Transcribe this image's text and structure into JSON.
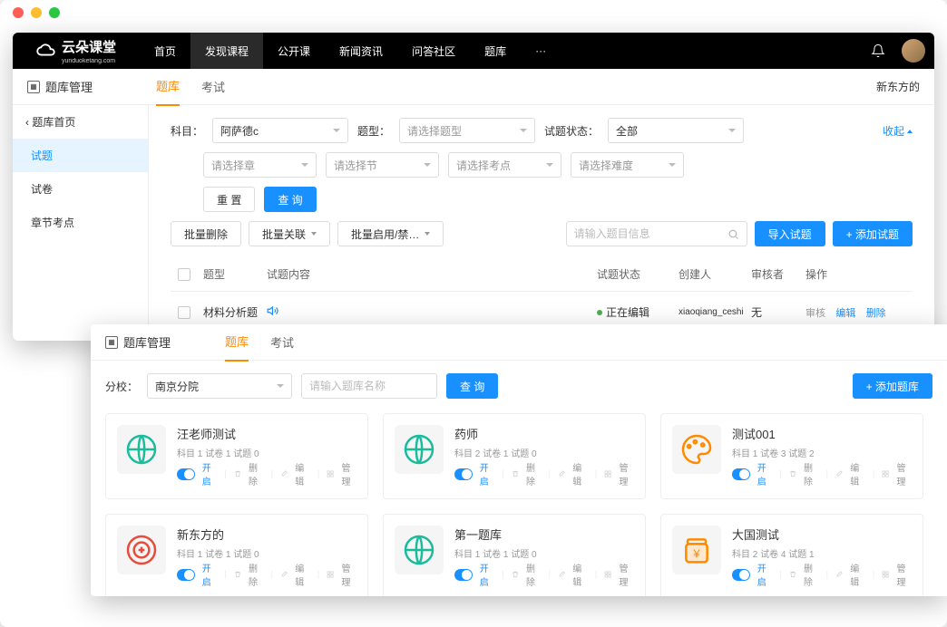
{
  "logo": {
    "main": "云朵课堂",
    "sub": "yunduoketang.com"
  },
  "topnav": [
    "首页",
    "发现课程",
    "公开课",
    "新闻资讯",
    "问答社区",
    "题库",
    "···"
  ],
  "topnav_active": 1,
  "w1": {
    "title": "题库管理",
    "tabs": [
      "题库",
      "考试"
    ],
    "tab_active": 0,
    "account": "新东方的",
    "breadcrumb": "‹ 题库首页",
    "side": [
      "试题",
      "试卷",
      "章节考点"
    ],
    "side_active": 0,
    "filters": {
      "subject_label": "科目：",
      "subject_val": "阿萨德c",
      "type_label": "题型：",
      "type_ph": "请选择题型",
      "status_label": "试题状态：",
      "status_val": "全部",
      "chapter_ph": "请选择章",
      "section_ph": "请选择节",
      "point_ph": "请选择考点",
      "difficulty_ph": "请选择难度",
      "collapse": "收起"
    },
    "buttons": {
      "reset": "重 置",
      "search": "查 询"
    },
    "bulk": {
      "delete": "批量删除",
      "relate": "批量关联",
      "enable": "批量启用/禁…"
    },
    "search_ph": "请输入题目信息",
    "import_btn": "导入试题",
    "add_btn": "+ 添加试题",
    "cols": {
      "type": "题型",
      "content": "试题内容",
      "status": "试题状态",
      "creator": "创建人",
      "reviewer": "审核者",
      "ops": "操作"
    },
    "row": {
      "type": "材料分析题",
      "status": "正在编辑",
      "creator": "xiaoqiang_ceshi",
      "reviewer": "无",
      "op_review": "审核",
      "op_edit": "编辑",
      "op_delete": "删除"
    }
  },
  "w2": {
    "title": "题库管理",
    "tabs": [
      "题库",
      "考试"
    ],
    "tab_active": 0,
    "branch_label": "分校：",
    "branch_val": "南京分院",
    "name_ph": "请输入题库名称",
    "search_btn": "查 询",
    "add_btn": "+ 添加题库",
    "card_ops": {
      "open": "开启",
      "delete": "删除",
      "edit": "编辑",
      "manage": "管理"
    },
    "cards": [
      {
        "title": "汪老师测试",
        "meta": "科目 1  试卷 1  试题 0",
        "icon": "green"
      },
      {
        "title": "药师",
        "meta": "科目 2  试卷 1  试题 0",
        "icon": "green"
      },
      {
        "title": "测试001",
        "meta": "科目 1  试卷 3  试题 2",
        "icon": "orange"
      },
      {
        "title": "新东方的",
        "meta": "科目 1  试卷 1  试题 0",
        "icon": "red"
      },
      {
        "title": "第一题库",
        "meta": "科目 1  试卷 1  试题 0",
        "icon": "green"
      },
      {
        "title": "大国测试",
        "meta": "科目 2  试卷 4  试题 1",
        "icon": "gold"
      }
    ]
  }
}
